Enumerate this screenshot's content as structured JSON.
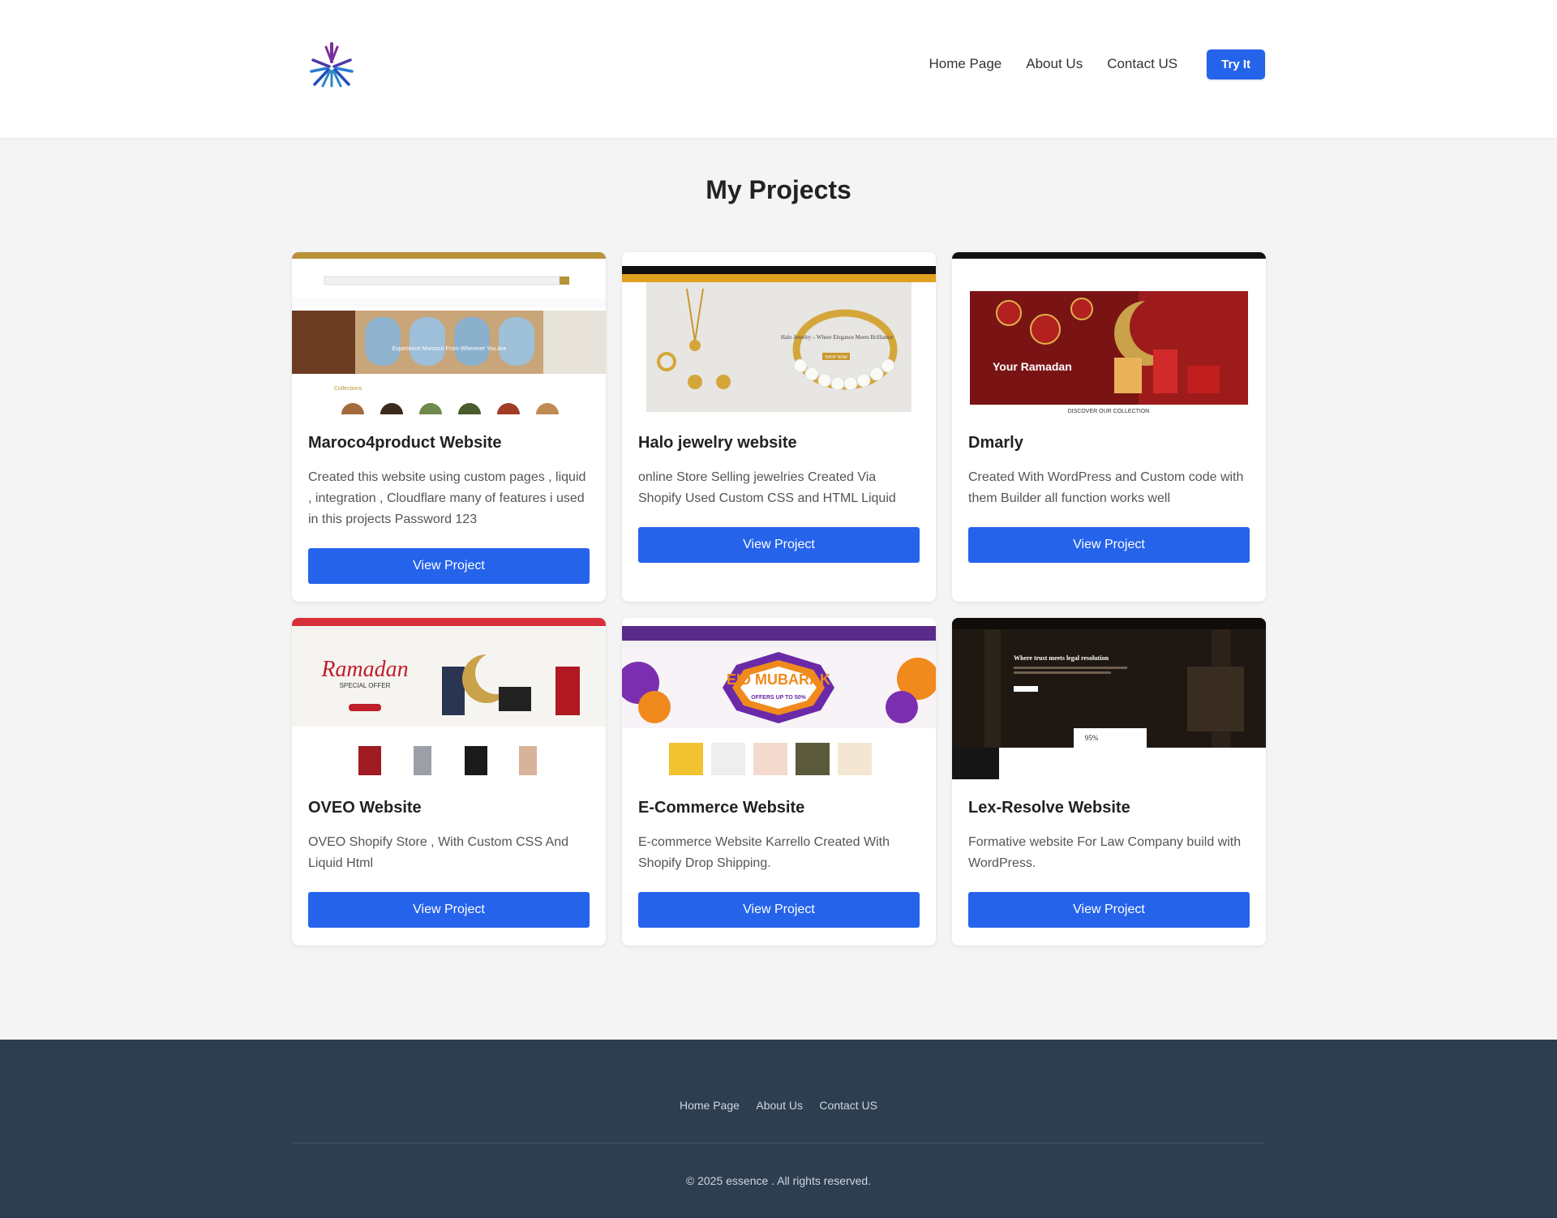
{
  "header": {
    "logo": "essence-logo",
    "nav": [
      "Home Page",
      "About Us",
      "Contact US"
    ],
    "cta": "Try It"
  },
  "main": {
    "title": "My Projects",
    "projects": [
      {
        "title": "Maroco4product Website",
        "description": "Created this website using custom pages , liquid , integration , Cloudflare  many of features i used in this projects Password 123",
        "button": "View Project",
        "thumbnail_text": "Experience Morocco From Wherever You Are",
        "thumbnail_label": "Collections"
      },
      {
        "title": "Halo jewelry website",
        "description": "online Store Selling jewelries Created Via Shopify Used Custom CSS and  HTML Liquid",
        "button": "View Project",
        "thumbnail_text": "Halo Jewelry – Where Elegance Meets Brilliance",
        "thumbnail_label": "SHOP NOW"
      },
      {
        "title": "Dmarly",
        "description": "Created With WordPress and Custom code with them Builder all function works well",
        "button": "View Project",
        "thumbnail_text": "Your Ramadan",
        "thumbnail_label": "DISCOVER OUR COLLECTION"
      },
      {
        "title": "OVEO Website",
        "description": "OVEO Shopify Store , With Custom CSS And Liquid Html",
        "button": "View Project",
        "thumbnail_text": "Ramadan",
        "thumbnail_label": "SPECIAL OFFER"
      },
      {
        "title": "E-Commerce Website",
        "description": "E-commerce Website Karrello Created With Shopify Drop Shipping.",
        "button": "View Project",
        "thumbnail_text": "EID MUBARAK",
        "thumbnail_label": "OFFERS UP TO 50%"
      },
      {
        "title": "Lex-Resolve Website",
        "description": "Formative website For Law Company build with WordPress.",
        "button": "View Project",
        "thumbnail_text": "Where trust meets legal resolution",
        "thumbnail_label": "95%"
      }
    ]
  },
  "footer": {
    "nav": [
      "Home Page",
      "About Us",
      "Contact US"
    ],
    "copyright": "© 2025 essence . All rights reserved."
  },
  "colors": {
    "accent": "#2563eb",
    "footer_bg": "#2d3e50",
    "page_bg": "#f4f4f5"
  }
}
